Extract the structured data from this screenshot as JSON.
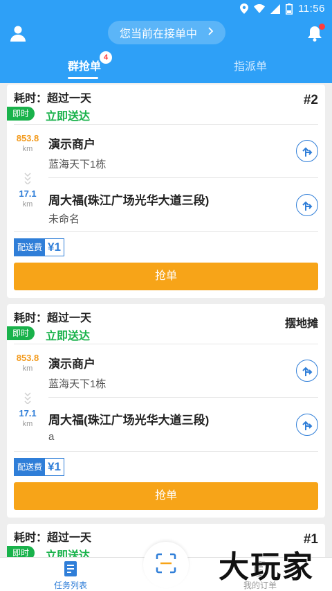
{
  "status_bar": {
    "time": "11:56",
    "battery": "12"
  },
  "header": {
    "status_text": "您当前在接单中",
    "tabs": [
      {
        "label": "群抢单",
        "badge": "4",
        "active": true
      },
      {
        "label": "指派单",
        "active": false
      }
    ]
  },
  "orders": [
    {
      "elapsed": "耗时：超过一天",
      "tag": "#2",
      "instant_label": "即时",
      "delivery_mode": "立即送达",
      "pickup": {
        "distance": "853.8",
        "unit": "km",
        "name": "演示商户",
        "address": "蓝海天下1栋"
      },
      "dropoff": {
        "distance": "17.1",
        "unit": "km",
        "name": "周大福(珠江广场光华大道三段)",
        "address": "未命名"
      },
      "fee_label": "配送费",
      "fee_value": "¥1",
      "action": "抢单"
    },
    {
      "elapsed": "耗时：超过一天",
      "tag": "摆地摊",
      "instant_label": "即时",
      "delivery_mode": "立即送达",
      "pickup": {
        "distance": "853.8",
        "unit": "km",
        "name": "演示商户",
        "address": "蓝海天下1栋"
      },
      "dropoff": {
        "distance": "17.1",
        "unit": "km",
        "name": "周大福(珠江广场光华大道三段)",
        "address": "a"
      },
      "fee_label": "配送费",
      "fee_value": "¥1",
      "action": "抢单"
    },
    {
      "elapsed": "耗时：超过一天",
      "tag": "#1",
      "instant_label": "即时",
      "delivery_mode": "立即送达"
    }
  ],
  "bottom_nav": [
    {
      "label": "任务列表",
      "icon": "task-list-icon",
      "active": true
    },
    {
      "label": "我的订单",
      "icon": "orders-icon",
      "active": false
    }
  ],
  "watermark": "大玩家",
  "colors": {
    "primary": "#2ea0f7",
    "grab": "#f7a418",
    "instant": "#19b24b",
    "accent": "#2f7ed8"
  }
}
